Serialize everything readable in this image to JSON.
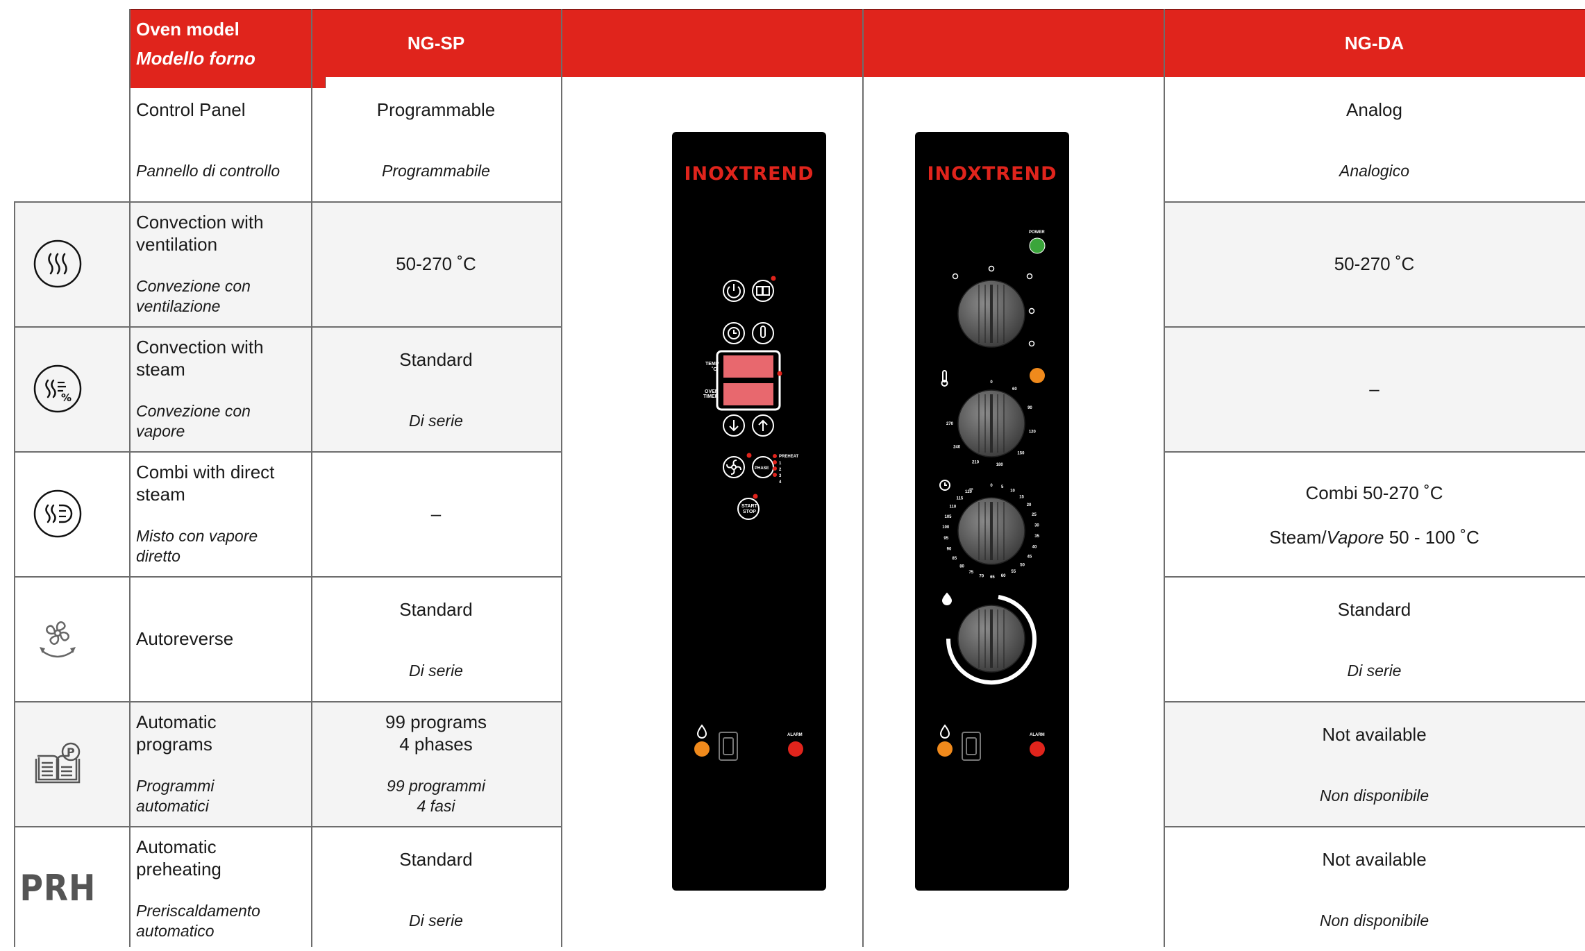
{
  "header": {
    "model_en": "Oven model",
    "model_it": "Modello forno",
    "col_sp": "NG-SP",
    "col_da": "NG-DA"
  },
  "rows": [
    {
      "en": "Control Panel",
      "it": "Pannello di controllo",
      "icon": "none",
      "sp": "Programmable",
      "sp_it": "Programmabile",
      "da": "Analog",
      "da_it": "Analogico"
    },
    {
      "en": "Convection with ventilation",
      "it": "Convezione con ventilazione",
      "icon": "convection-heat-icon",
      "sp": "50-270 ˚C",
      "sp_it": "",
      "da": "50-270 ˚C",
      "da_it": ""
    },
    {
      "en": "Convection with steam",
      "it": "Convezione con vapore",
      "icon": "steam-percent-icon",
      "sp": "Standard",
      "sp_it": "Di serie",
      "da": "–",
      "da_it": ""
    },
    {
      "en": "Combi with direct steam",
      "it": "Misto con vapore diretto",
      "icon": "direct-steam-icon",
      "sp": "–",
      "sp_it": "",
      "da": "Combi 50-270 ˚C",
      "da_2a": "Steam/",
      "da_2b": "Vapore",
      "da_2c": " 50 - 100 ˚C"
    },
    {
      "en": "Autoreverse",
      "it": "",
      "icon": "fan-reverse-icon",
      "sp": "Standard",
      "sp_it": "Di serie",
      "da": "Standard",
      "da_it": "Di serie"
    },
    {
      "en": "Automatic programs",
      "it": "Programmi automatici",
      "icon": "program-book-icon",
      "sp": "99 programs",
      "sp_2": "4 phases",
      "sp_it": "99 programmi",
      "sp_it2": "4 fasi",
      "da": "Not available",
      "da_it": "Non disponibile"
    },
    {
      "en": "Automatic preheating",
      "it": "Preriscaldamento automatico",
      "icon": "prh-icon",
      "icon_text": "PRH",
      "sp": "Standard",
      "sp_it": "Di serie",
      "da": "Not available",
      "da_it": "Non disponibile"
    }
  ],
  "panel_sp": {
    "brand": "INOXTREND",
    "temp_label": "TEMP",
    "temp_unit": "˚C",
    "oven_label": "OVEN",
    "timer_label": "TIMER",
    "phase_label": "PHASE",
    "preheat_label": "PREHEAT",
    "phase_marks": [
      "1",
      "2",
      "3",
      "4"
    ],
    "start_label": "START",
    "stop_label": "STOP",
    "alarm_label": "ALARM"
  },
  "panel_da": {
    "brand": "INOXTREND",
    "power_label": "POWER",
    "alarm_label": "ALARM",
    "temp_ticks": [
      "0",
      "60",
      "90",
      "120",
      "150",
      "180",
      "210",
      "240",
      "270"
    ],
    "timer_ticks": [
      "0",
      "5",
      "10",
      "15",
      "20",
      "25",
      "30",
      "35",
      "40",
      "45",
      "50",
      "55",
      "60",
      "65",
      "70",
      "75",
      "80",
      "85",
      "90",
      "95",
      "100",
      "105",
      "110",
      "115",
      "120"
    ],
    "timer_infinity": "∞"
  },
  "colors": {
    "accent": "#e0241c",
    "row_alt": "#f4f4f4",
    "led_red": "#e0241c",
    "led_orange": "#f08a1c",
    "led_green": "#3aa53a",
    "display_red": "#e8686e"
  }
}
